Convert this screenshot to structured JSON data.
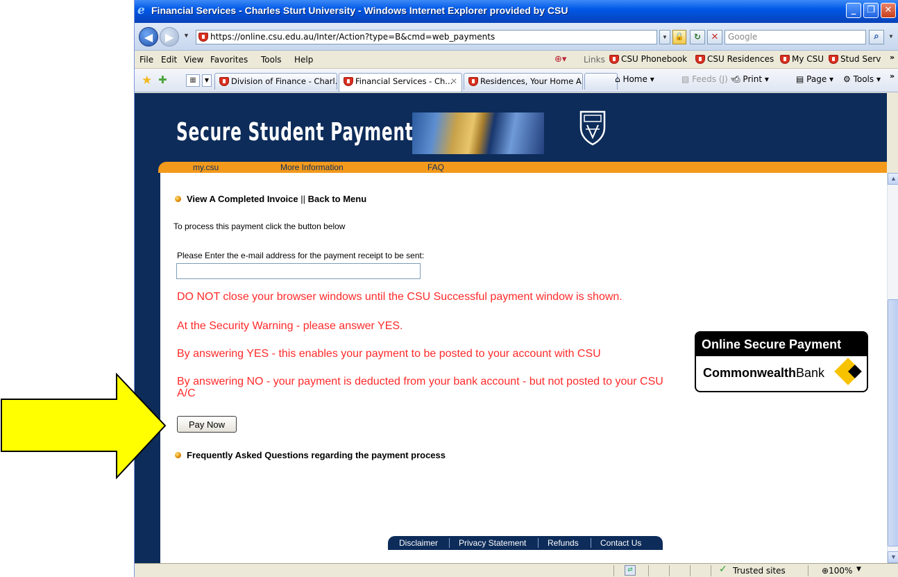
{
  "window": {
    "title": "Financial Services - Charles Sturt University - Windows Internet Explorer provided by CSU"
  },
  "address": {
    "url": "https://online.csu.edu.au/Inter/Action?type=B&cmd=web_payments",
    "search_placeholder": "Google"
  },
  "menu": {
    "file": "File",
    "edit": "Edit",
    "view": "View",
    "favorites": "Favorites",
    "tools": "Tools",
    "help": "Help",
    "links_label": "Links",
    "links": [
      "CSU Phonebook",
      "CSU Residences",
      "My CSU",
      "Stud Serv"
    ]
  },
  "tabs": [
    {
      "label": "Division of Finance - Charl..."
    },
    {
      "label": "Financial Services - Ch..."
    },
    {
      "label": "Residences, Your Home A..."
    }
  ],
  "commands": {
    "home": "Home",
    "feeds": "Feeds (J)",
    "print": "Print",
    "page": "Page",
    "tools": "Tools"
  },
  "banner": {
    "title": "Secure Student Payments",
    "nav": [
      "my.csu",
      "More Information",
      "FAQ"
    ]
  },
  "content": {
    "view_invoice": "View A Completed Invoice",
    "separator": "||",
    "back_to_menu": "Back to Menu",
    "process_text": "To process this payment click the button below",
    "email_label": "Please Enter the e-mail address for the payment receipt to be sent:",
    "email_value": "",
    "warnings": [
      "DO NOT close your browser windows until the CSU Successful payment window is shown.",
      "At the Security Warning - please answer YES.",
      "By answering YES - this enables your payment to be posted to your account with CSU",
      "By answering NO - your payment is deducted from your bank account - but not posted to your CSU A/C"
    ],
    "pay_button": "Pay Now",
    "faq_link": "Frequently Asked Questions regarding the payment process"
  },
  "cba_logo": {
    "heading": "Online Secure Payment",
    "bank_bold": "Commonwealth",
    "bank_light": "Bank"
  },
  "footer": {
    "links": [
      "Disclaimer",
      "Privacy Statement",
      "Refunds",
      "Contact Us"
    ]
  },
  "status": {
    "zone": "Trusted sites",
    "zoom": "100%"
  },
  "colors": {
    "page_navy": "#0d2c5a",
    "nav_orange": "#f39a1d",
    "warning_red": "#ff2a2a",
    "arrow_yellow": "#ffff00"
  }
}
